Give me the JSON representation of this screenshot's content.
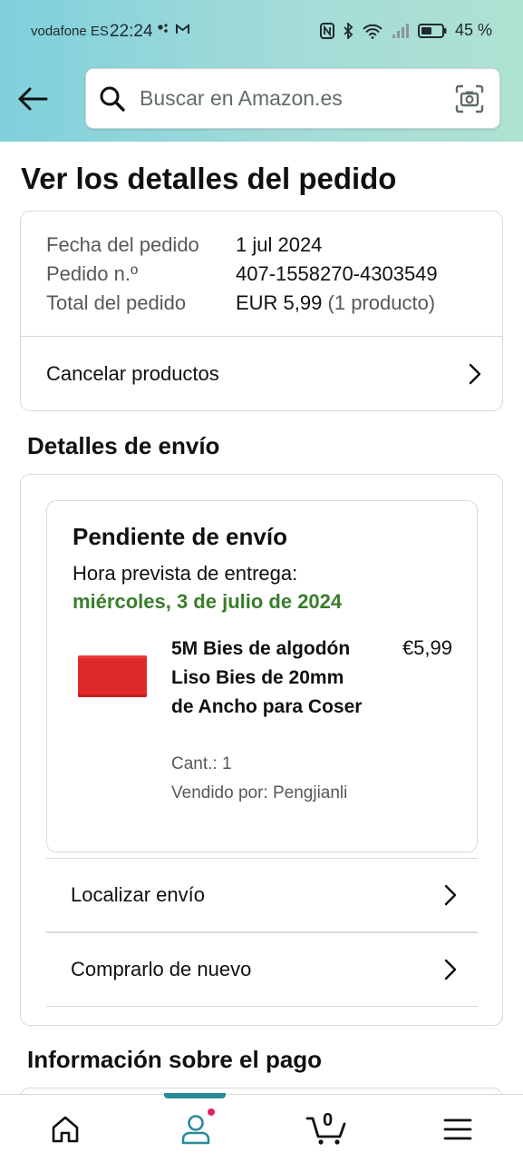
{
  "status_bar": {
    "carrier": "vodafone ES",
    "time": "22:24",
    "battery": "45 %"
  },
  "search": {
    "placeholder": "Buscar en Amazon.es"
  },
  "page": {
    "title": "Ver los detalles del pedido"
  },
  "summary": {
    "rows": [
      {
        "label": "Fecha del pedido",
        "value": "1 jul 2024"
      },
      {
        "label": "Pedido n.º",
        "value": "407-1558270-4303549"
      },
      {
        "label": "Total del pedido",
        "value": "EUR 5,99",
        "extra": "(1 producto)"
      }
    ],
    "cancel_label": "Cancelar productos"
  },
  "shipping": {
    "section_title": "Detalles de envío",
    "status": "Pendiente de envío",
    "eta_label": "Hora prevista de entrega:",
    "eta_date": "miércoles, 3 de julio de 2024",
    "product": {
      "title": "5M Bies de algodón Liso Bies de 20mm de Ancho para Coser",
      "price": "€5,99",
      "quantity": "Cant.: 1",
      "seller": "Vendido por: Pengjianli"
    },
    "actions": [
      {
        "label": "Localizar envío"
      },
      {
        "label": "Comprarlo de nuevo"
      }
    ]
  },
  "payment": {
    "section_title": "Información sobre el pago"
  },
  "nav": {
    "active": "account",
    "cart_count": "0"
  },
  "colors": {
    "header_gradient_start": "#7fd0dc",
    "header_gradient_end": "#aee2d2",
    "eta_green": "#3a7d2b",
    "nav_accent": "#2a8a9a",
    "notification_dot": "#e0245e",
    "product_red": "#e02a2a"
  }
}
